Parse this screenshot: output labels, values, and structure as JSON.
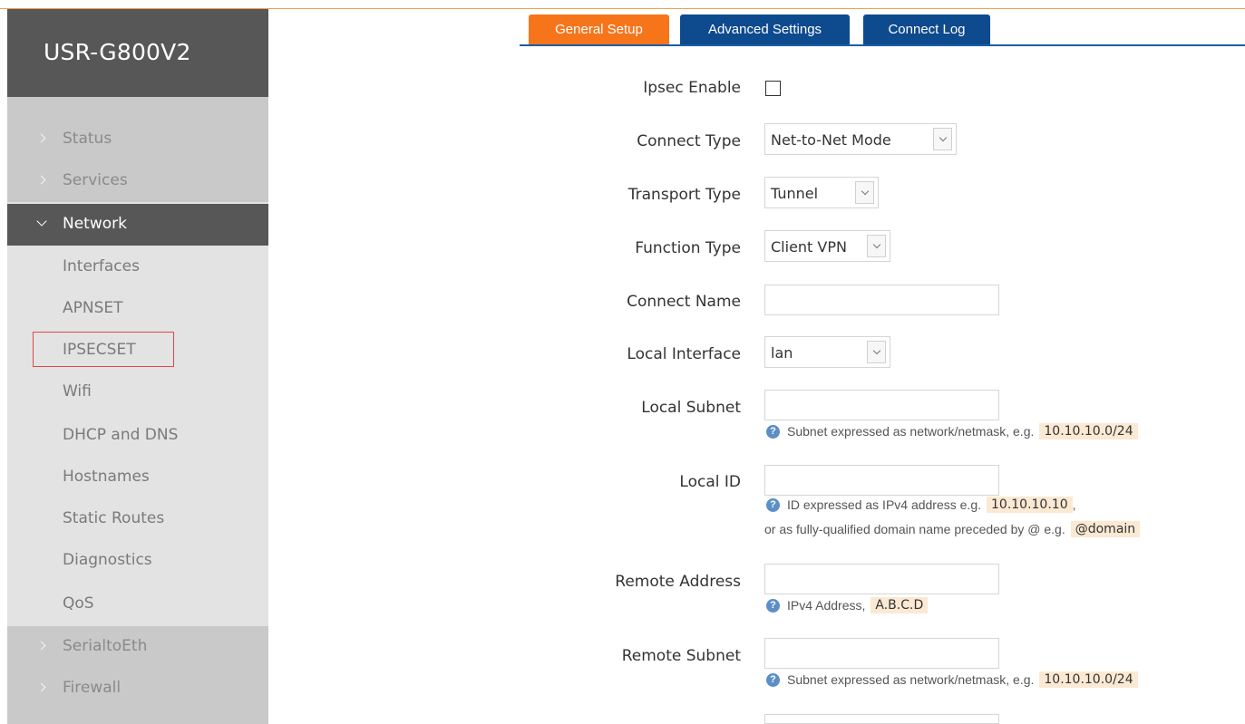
{
  "app": {
    "brand": "USR-G800V2"
  },
  "sidebar": {
    "groups_top": [
      {
        "label": "Status"
      },
      {
        "label": "Services"
      }
    ],
    "active_group": {
      "label": "Network"
    },
    "network_items": [
      {
        "label": "Interfaces"
      },
      {
        "label": "APNSET"
      },
      {
        "label": "IPSECSET"
      },
      {
        "label": "Wifi"
      },
      {
        "label": "DHCP and DNS"
      },
      {
        "label": "Hostnames"
      },
      {
        "label": "Static Routes"
      },
      {
        "label": "Diagnostics"
      },
      {
        "label": "QoS"
      }
    ],
    "groups_bottom": [
      {
        "label": "SerialtoEth"
      },
      {
        "label": "Firewall"
      }
    ]
  },
  "tabs": [
    {
      "label": "General Setup",
      "active": true
    },
    {
      "label": "Advanced Settings",
      "active": false
    },
    {
      "label": "Connect Log",
      "active": false
    }
  ],
  "form": {
    "ipsec_enable": {
      "label": "Ipsec Enable",
      "checked": false
    },
    "connect_type": {
      "label": "Connect Type",
      "value": "Net-to-Net Mode"
    },
    "transport_type": {
      "label": "Transport Type",
      "value": "Tunnel"
    },
    "function_type": {
      "label": "Function Type",
      "value": "Client VPN"
    },
    "connect_name": {
      "label": "Connect Name",
      "value": ""
    },
    "local_interface": {
      "label": "Local Interface",
      "value": "lan"
    },
    "local_subnet": {
      "label": "Local Subnet",
      "value": "",
      "hint": "Subnet expressed as network/netmask, e.g.",
      "example": "10.10.10.0/24"
    },
    "local_id": {
      "label": "Local ID",
      "value": "",
      "hint_line1": "ID expressed as IPv4 address e.g.",
      "example1": "10.10.10.10",
      "sep": ",",
      "hint_line2": "or as fully-qualified domain name preceded by @ e.g.",
      "example2": "@domain"
    },
    "remote_address": {
      "label": "Remote Address",
      "value": "",
      "hint": "IPv4 Address,",
      "example": "A.B.C.D"
    },
    "remote_subnet": {
      "label": "Remote Subnet",
      "value": "",
      "hint": "Subnet expressed as network/netmask, e.g.",
      "example": "10.10.10.0/24"
    }
  },
  "colors": {
    "accent_orange": "#f6751b",
    "tab_blue": "#0e4a8e",
    "sidebar_dark": "#575757",
    "highlight_red": "#e0474c"
  }
}
